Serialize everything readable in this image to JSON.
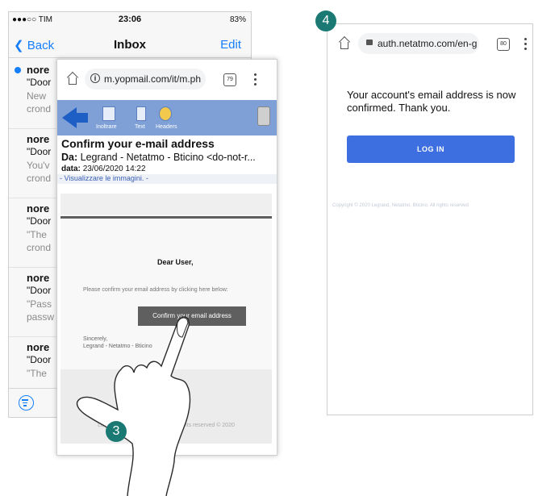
{
  "inbox": {
    "status": {
      "carrier": "●●●○○ TIM",
      "time": "23:06",
      "battery": "83%"
    },
    "back_label": "Back",
    "title": "Inbox",
    "edit_label": "Edit",
    "messages": [
      {
        "from": "nore",
        "subject": "\"Door",
        "preview": [
          "New",
          "crond"
        ]
      },
      {
        "from": "nore",
        "subject": "\"Door",
        "preview": [
          "You'v",
          "crond"
        ]
      },
      {
        "from": "nore",
        "subject": "\"Door",
        "preview": [
          "\"The",
          "crond"
        ]
      },
      {
        "from": "nore",
        "subject": "\"Door",
        "preview": [
          "\"Pass",
          "passw"
        ]
      },
      {
        "from": "nore",
        "subject": "\"Door",
        "preview": [
          "\"The",
          ""
        ]
      }
    ]
  },
  "browser_left": {
    "url": "m.yopmail.com/it/m.ph",
    "tab_count": "79",
    "toolbar": {
      "forward": "Inoltrare",
      "text": "Text",
      "headers": "Headers"
    },
    "mail_subject": "Confirm your e-mail address",
    "from_label": "Da:",
    "from_value": "Legrand - Netatmo - Bticino <do-not-r...",
    "date_label": "data:",
    "date_value": "23/06/2020 14:22",
    "images_link": "- Visualizzare le immagini. -",
    "email": {
      "greeting": "Dear User,",
      "instruction": "Please confirm your email address by clicking here below:",
      "button": "Confirm your email address",
      "sincerely": "Sincerely,",
      "signature": "Legrand - Netatmo - Bticino",
      "footer": "Legrand - Netatmo - Bticino. All rights reserved © 2020"
    }
  },
  "browser_right": {
    "url": "auth.netatmo.com/en-g",
    "tab_count": "80",
    "message": "Your account's email address is now confirmed. Thank you.",
    "login_button": "LOG IN",
    "copyright": "Copyright © 2020 Legrand, Netatmo, Bticino. All rights reserved"
  },
  "steps": {
    "left": "3",
    "right": "4"
  },
  "colors": {
    "ios_blue": "#147efb",
    "login_blue": "#3e6fe0",
    "badge_teal": "#1a7a73"
  }
}
